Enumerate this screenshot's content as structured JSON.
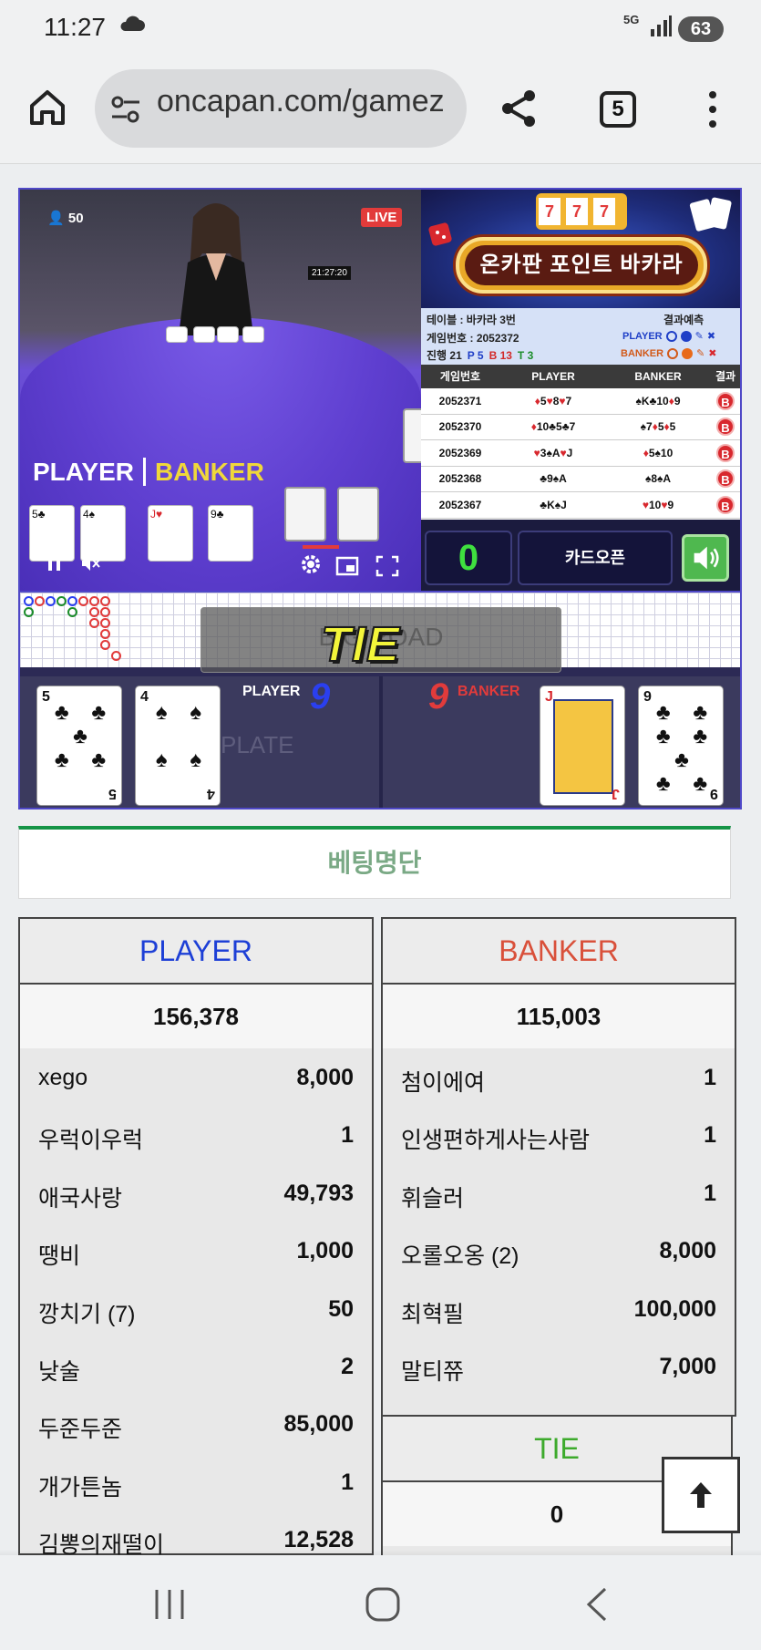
{
  "status_bar": {
    "time": "11:27",
    "network": "5G",
    "battery": "63"
  },
  "browser": {
    "url": "oncapan.com/gamez",
    "tab_count": "5"
  },
  "video": {
    "viewers": "50",
    "live_badge": "LIVE",
    "clock": "21:27:20",
    "player_label": "PLAYER",
    "banker_label": "BANKER"
  },
  "banner": {
    "title": "온카판 포인트 바카라",
    "slot": [
      "7",
      "7",
      "7"
    ]
  },
  "info": {
    "table": "테이블 : 바카라 3번",
    "game_no": "게임번호 : 2052372",
    "progress_label": "진행 21",
    "p_count": "P 5",
    "b_count": "B 13",
    "t_count": "T 3",
    "prediction_label": "결과예측",
    "player_pred": "PLAYER",
    "banker_pred": "BANKER"
  },
  "results": {
    "headers": [
      "게임번호",
      "PLAYER",
      "BANKER",
      "결과"
    ],
    "rows": [
      {
        "game": "2052371",
        "player": "♦5♥8♥7",
        "banker": "♠K♣10♦9",
        "result": "B"
      },
      {
        "game": "2052370",
        "player": "♦10♣5♣7",
        "banker": "♠7♦5♦5",
        "result": "B"
      },
      {
        "game": "2052369",
        "player": "♥3♠A♥J",
        "banker": "♦5♠10",
        "result": "B"
      },
      {
        "game": "2052368",
        "player": "♣9♠A",
        "banker": "♠8♠A",
        "result": "B"
      },
      {
        "game": "2052367",
        "player": "♣K♠J",
        "banker": "♥10♥9",
        "result": "B"
      }
    ]
  },
  "controls": {
    "countdown": "0",
    "card_open": "카드오픈"
  },
  "overlay": {
    "ghost_text": "BIG ROAD",
    "result_text": "TIE",
    "ghost_plate": "PLATE"
  },
  "hands": {
    "player_label": "PLAYER",
    "player_score": "9",
    "banker_label": "BANKER",
    "banker_score": "9",
    "player_cards": [
      {
        "rank": "5",
        "suit": "♣"
      },
      {
        "rank": "4",
        "suit": "♠"
      }
    ],
    "banker_cards": [
      {
        "rank": "J",
        "suit": "♥"
      },
      {
        "rank": "9",
        "suit": "♣"
      }
    ]
  },
  "betting": {
    "title": "베팅명단",
    "player": {
      "label": "PLAYER",
      "total": "156,378",
      "items": [
        {
          "name": "xego",
          "value": "8,000"
        },
        {
          "name": "우럭이우럭",
          "value": "1"
        },
        {
          "name": "애국사랑",
          "value": "49,793"
        },
        {
          "name": "땡비",
          "value": "1,000"
        },
        {
          "name": "깡치기 (7)",
          "value": "50"
        },
        {
          "name": "낮술",
          "value": "2"
        },
        {
          "name": "두준두준",
          "value": "85,000"
        },
        {
          "name": "개가튼놈",
          "value": "1"
        },
        {
          "name": "김뽕의재떨이",
          "value": "12,528"
        }
      ]
    },
    "banker": {
      "label": "BANKER",
      "total": "115,003",
      "items": [
        {
          "name": "첨이에여",
          "value": "1"
        },
        {
          "name": "인생편하게사는사람",
          "value": "1"
        },
        {
          "name": "휘슬러",
          "value": "1"
        },
        {
          "name": "오롤오옹 (2)",
          "value": "8,000"
        },
        {
          "name": "최혁필",
          "value": "100,000"
        },
        {
          "name": "말티쮸",
          "value": "7,000"
        }
      ]
    },
    "tie": {
      "label": "TIE",
      "total": "0"
    }
  },
  "colors": {
    "player": "#1d3fd6",
    "banker": "#d9503a",
    "tie": "#3daa2c",
    "accent_green": "#159447"
  }
}
